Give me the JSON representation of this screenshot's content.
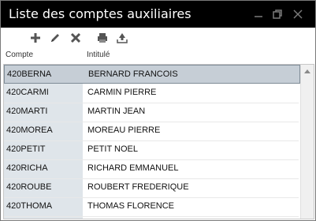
{
  "window": {
    "title": "Liste des comptes auxiliaires"
  },
  "toolbar": {
    "icons": [
      "add-icon",
      "edit-icon",
      "delete-icon",
      "print-icon",
      "export-icon"
    ]
  },
  "table": {
    "columns": [
      "Compte",
      "Intitulé"
    ],
    "rows": [
      {
        "compte": "420BERNA",
        "intitule": "BERNARD FRANCOIS",
        "selected": true
      },
      {
        "compte": "420CARMI",
        "intitule": "CARMIN PIERRE"
      },
      {
        "compte": "420MARTI",
        "intitule": "MARTIN JEAN"
      },
      {
        "compte": "420MOREA",
        "intitule": "MOREAU PIERRE"
      },
      {
        "compte": "420PETIT",
        "intitule": "PETIT NOEL"
      },
      {
        "compte": "420RICHA",
        "intitule": "RICHARD EMMANUEL"
      },
      {
        "compte": "420ROUBE",
        "intitule": "ROUBERT FREDERIQUE"
      },
      {
        "compte": "420THOMA",
        "intitule": "THOMAS FLORENCE"
      }
    ]
  },
  "colors": {
    "titlebar": "#000000",
    "selection": "#c6ced6",
    "leftcol": "#dfe5ea"
  }
}
